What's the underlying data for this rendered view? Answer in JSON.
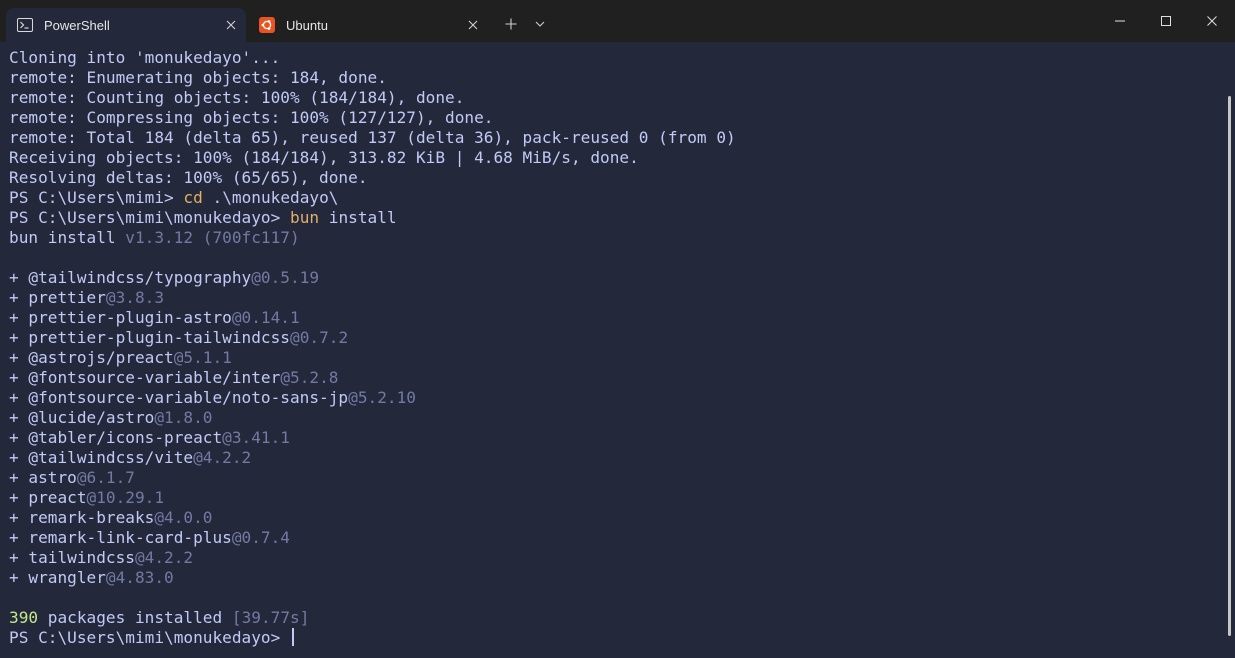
{
  "tabs": [
    {
      "label": "PowerShell",
      "icon": "powershell-icon",
      "active": true
    },
    {
      "label": "Ubuntu",
      "icon": "ubuntu-icon",
      "active": false
    }
  ],
  "colors": {
    "background": "#24283b",
    "titlebar": "#202020",
    "foreground": "#c0caf5",
    "dim": "#737aa2",
    "command": "#e0af68",
    "success": "#c3e88d",
    "ubuntu_orange": "#e95420"
  },
  "terminal": {
    "lines": [
      [
        {
          "t": "Cloning into 'monukedayo'..."
        }
      ],
      [
        {
          "t": "remote: Enumerating objects: 184, done."
        }
      ],
      [
        {
          "t": "remote: Counting objects: 100% (184/184), done."
        }
      ],
      [
        {
          "t": "remote: Compressing objects: 100% (127/127), done."
        }
      ],
      [
        {
          "t": "remote: Total 184 (delta 65), reused 137 (delta 36), pack-reused 0 (from 0)"
        }
      ],
      [
        {
          "t": "Receiving objects: 100% (184/184), 313.82 KiB | 4.68 MiB/s, done."
        }
      ],
      [
        {
          "t": "Resolving deltas: 100% (65/65), done."
        }
      ],
      [
        {
          "t": "PS C:\\Users\\mimi> "
        },
        {
          "t": "cd",
          "c": "yellow"
        },
        {
          "t": " .\\monukedayo\\"
        }
      ],
      [
        {
          "t": "PS C:\\Users\\mimi\\monukedayo> "
        },
        {
          "t": "bun",
          "c": "yellow"
        },
        {
          "t": " install"
        }
      ],
      [
        {
          "t": "bun install "
        },
        {
          "t": "v1.3.12 (700fc117)",
          "c": "dim"
        }
      ],
      [],
      [
        {
          "t": "+ @tailwindcss/typography"
        },
        {
          "t": "@0.5.19",
          "c": "dim"
        }
      ],
      [
        {
          "t": "+ prettier"
        },
        {
          "t": "@3.8.3",
          "c": "dim"
        }
      ],
      [
        {
          "t": "+ prettier-plugin-astro"
        },
        {
          "t": "@0.14.1",
          "c": "dim"
        }
      ],
      [
        {
          "t": "+ prettier-plugin-tailwindcss"
        },
        {
          "t": "@0.7.2",
          "c": "dim"
        }
      ],
      [
        {
          "t": "+ @astrojs/preact"
        },
        {
          "t": "@5.1.1",
          "c": "dim"
        }
      ],
      [
        {
          "t": "+ @fontsource-variable/inter"
        },
        {
          "t": "@5.2.8",
          "c": "dim"
        }
      ],
      [
        {
          "t": "+ @fontsource-variable/noto-sans-jp"
        },
        {
          "t": "@5.2.10",
          "c": "dim"
        }
      ],
      [
        {
          "t": "+ @lucide/astro"
        },
        {
          "t": "@1.8.0",
          "c": "dim"
        }
      ],
      [
        {
          "t": "+ @tabler/icons-preact"
        },
        {
          "t": "@3.41.1",
          "c": "dim"
        }
      ],
      [
        {
          "t": "+ @tailwindcss/vite"
        },
        {
          "t": "@4.2.2",
          "c": "dim"
        }
      ],
      [
        {
          "t": "+ astro"
        },
        {
          "t": "@6.1.7",
          "c": "dim"
        }
      ],
      [
        {
          "t": "+ preact"
        },
        {
          "t": "@10.29.1",
          "c": "dim"
        }
      ],
      [
        {
          "t": "+ remark-breaks"
        },
        {
          "t": "@4.0.0",
          "c": "dim"
        }
      ],
      [
        {
          "t": "+ remark-link-card-plus"
        },
        {
          "t": "@0.7.4",
          "c": "dim"
        }
      ],
      [
        {
          "t": "+ tailwindcss"
        },
        {
          "t": "@4.2.2",
          "c": "dim"
        }
      ],
      [
        {
          "t": "+ wrangler"
        },
        {
          "t": "@4.83.0",
          "c": "dim"
        }
      ],
      [],
      [
        {
          "t": "390",
          "c": "green"
        },
        {
          "t": " packages installed "
        },
        {
          "t": "[39.77s]",
          "c": "dim"
        }
      ],
      [
        {
          "t": "PS C:\\Users\\mimi\\monukedayo> "
        },
        {
          "cursor": true
        }
      ]
    ]
  }
}
